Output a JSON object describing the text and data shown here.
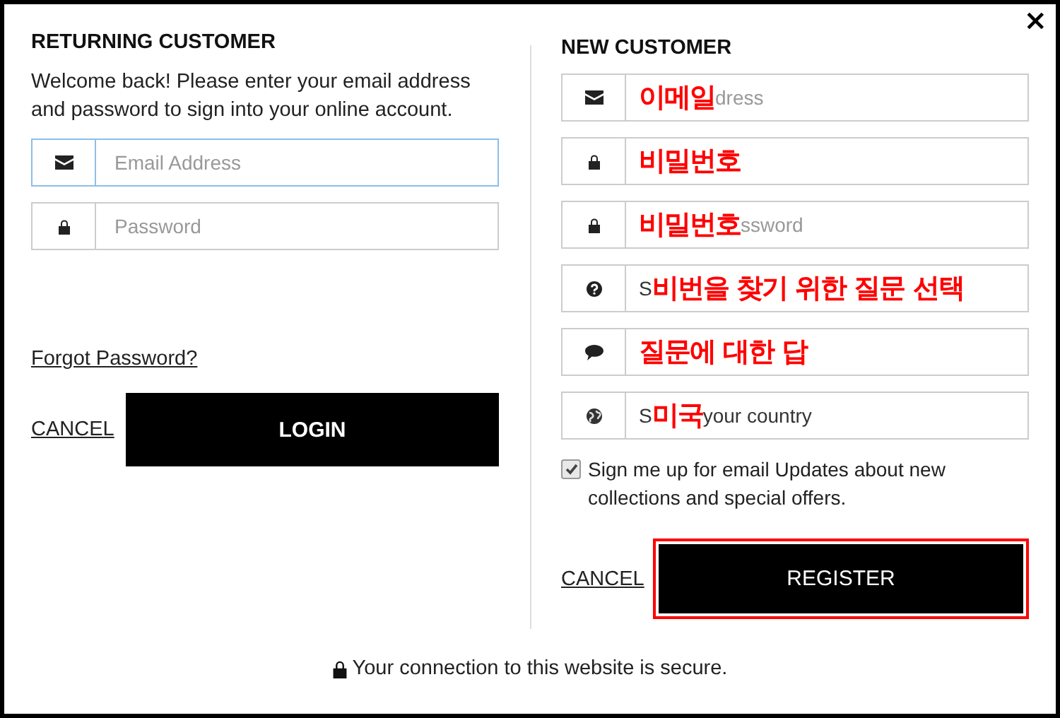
{
  "close": "×",
  "returning_customer": {
    "title": "RETURNING CUSTOMER",
    "intro": "Welcome back! Please enter your email address and password to sign into your online account.",
    "fields": [
      {
        "kind": "email",
        "placeholder": "Email Address",
        "focused": true
      },
      {
        "kind": "password",
        "placeholder": "Password",
        "focused": false
      }
    ],
    "forgot_link": "Forgot Password?",
    "cancel": "CANCEL",
    "login": "LOGIN"
  },
  "new_customer": {
    "title": "NEW CUSTOMER",
    "fields": [
      {
        "kind": "email",
        "annotation": "이메일",
        "text_after": "dress"
      },
      {
        "kind": "password",
        "annotation": "비밀번호"
      },
      {
        "kind": "password",
        "annotation": "비밀번호",
        "text_after": "ssword"
      },
      {
        "kind": "question",
        "text_before": "S",
        "annotation": "비번을 찾기 위한 질문 선택"
      },
      {
        "kind": "answer",
        "annotation": "질문에 대한 답"
      },
      {
        "kind": "country",
        "text_before": "S",
        "annotation": "미국",
        "text_after": "your country"
      }
    ],
    "newsletter": {
      "checked": true,
      "label": "Sign me up for email Updates about new collections and special offers."
    },
    "cancel": "CANCEL",
    "register": {
      "label": "REGISTER",
      "highlighted": true
    }
  },
  "footer": {
    "text": "Your connection to this website is secure."
  }
}
